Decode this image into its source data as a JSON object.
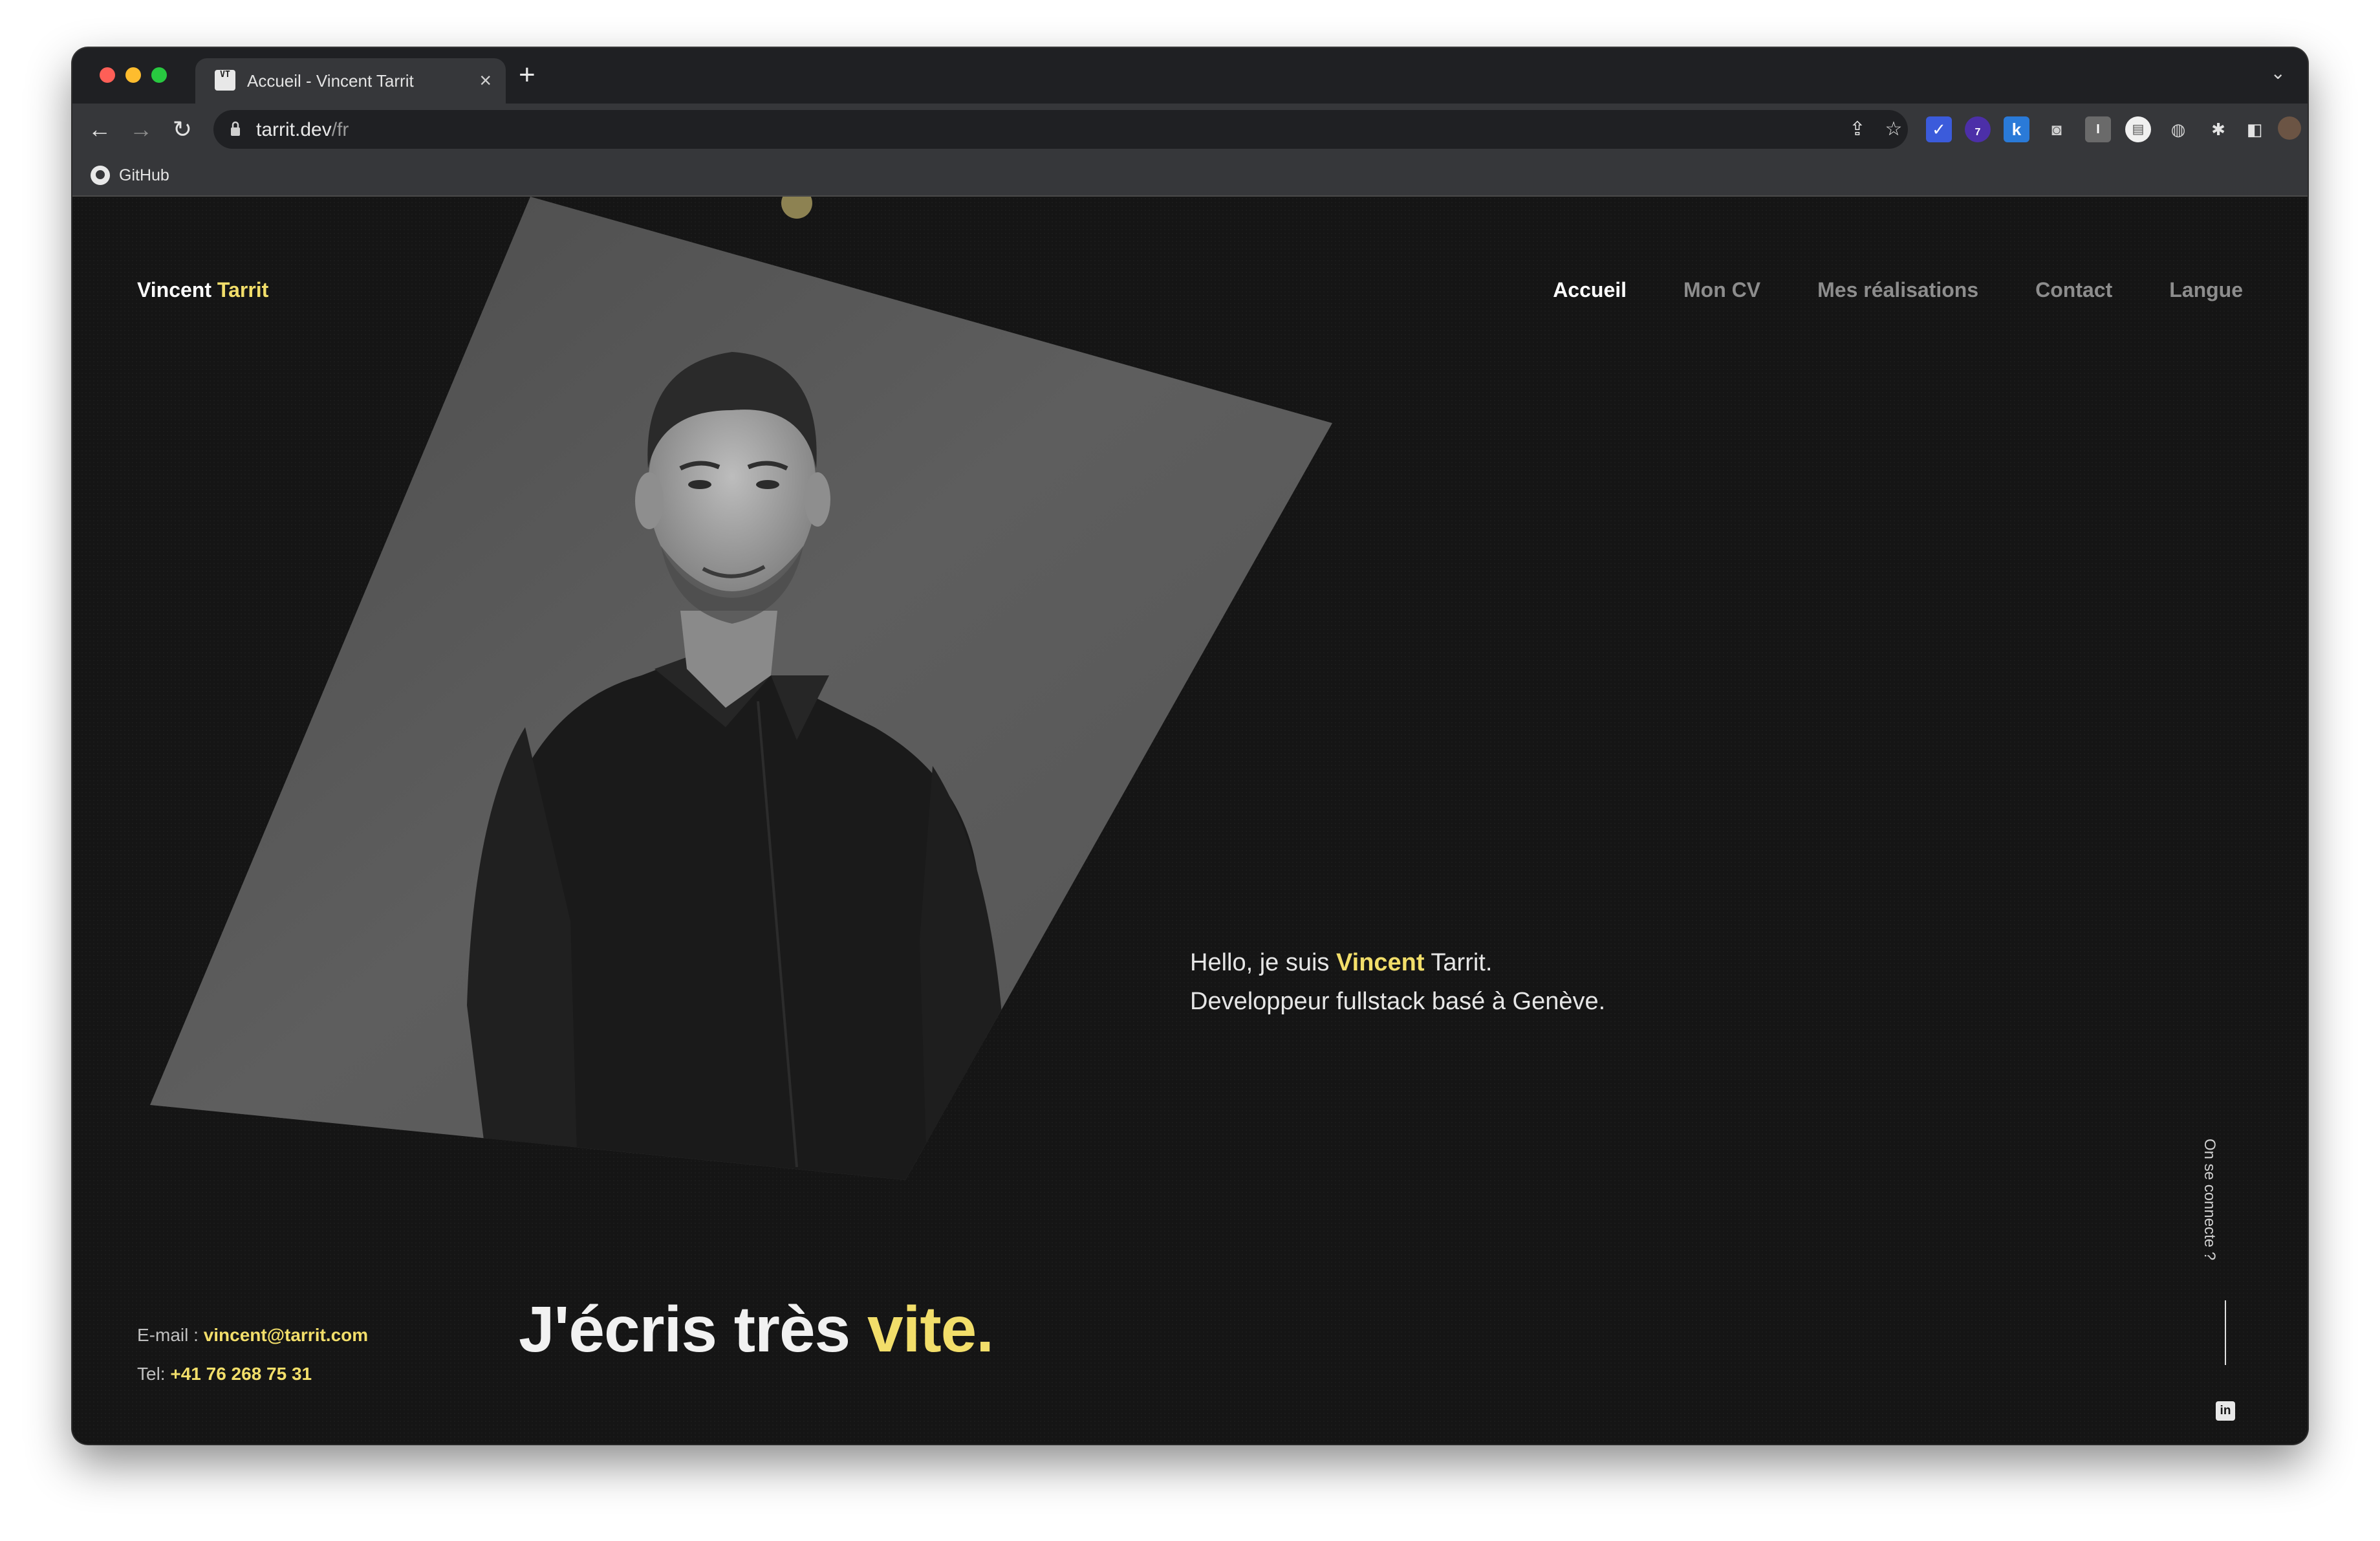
{
  "browser": {
    "tab_title": "Accueil - Vincent Tarrit",
    "favicon_text": "VT",
    "url_host": "tarrit.dev",
    "url_path": "/fr",
    "bookmark_label": "GitHub",
    "extension_badge": "7"
  },
  "site": {
    "brand_first": "Vincent",
    "brand_last": "Tarrit",
    "nav": [
      "Accueil",
      "Mon CV",
      "Mes réalisations",
      "Contact",
      "Langue"
    ],
    "active_nav": "Accueil",
    "intro_prefix": "Hello, je suis",
    "intro_first": "Vincent",
    "intro_last": "Tarrit.",
    "intro_line2": "Developpeur fullstack basé à Genève.",
    "email_label": "E-mail :",
    "email": "vincent@tarrit.com",
    "phone_label": "Tel:",
    "phone": "+41 76 268 75 31",
    "tagline_start": "J'écris très",
    "tagline_accent": "vite.",
    "social_label": "On se connecte ?",
    "linkedin_glyph": "in"
  },
  "colors": {
    "accent": "#f2de6a",
    "background": "#151515",
    "nav_inactive": "#8d8d8d"
  },
  "icons": [
    "lock-icon",
    "share-icon",
    "star-icon",
    "github-icon",
    "linkedin-icon",
    "back-icon",
    "forward-icon",
    "reload-icon",
    "extensions-icon",
    "more-icon"
  ]
}
